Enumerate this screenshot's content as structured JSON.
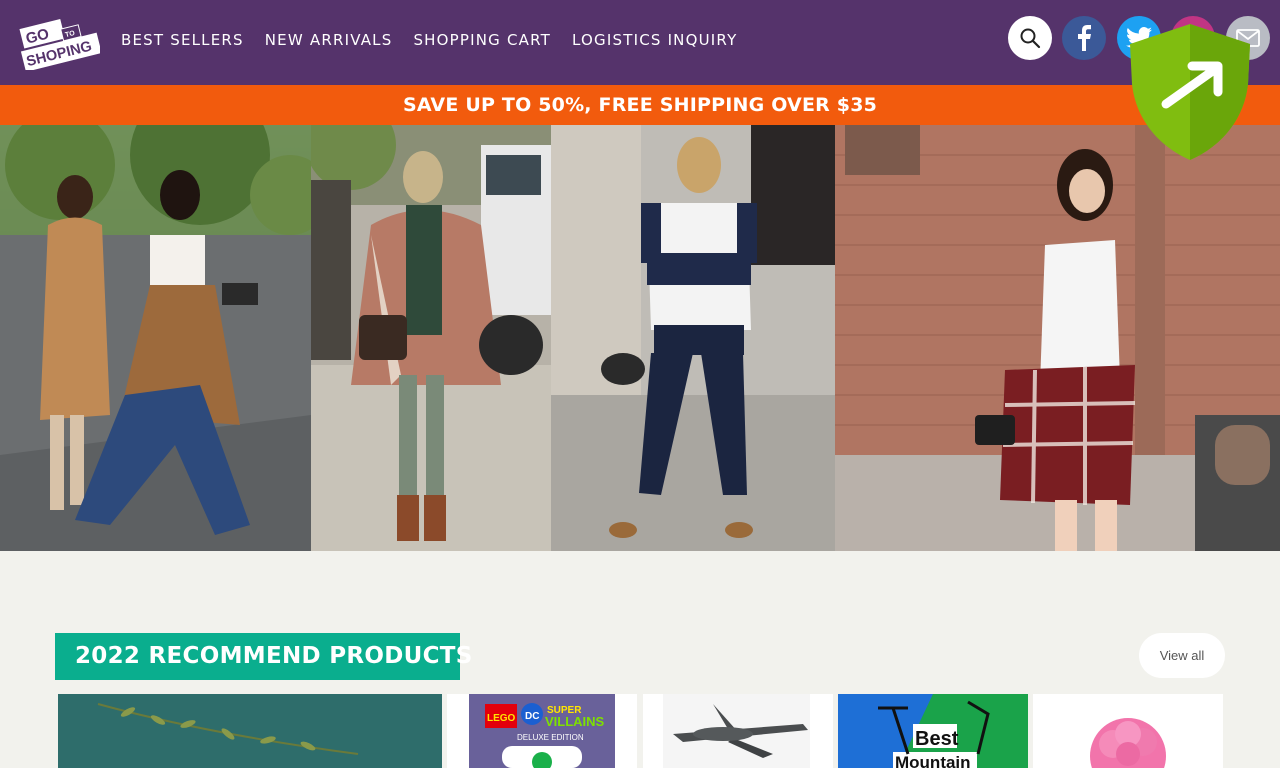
{
  "logo": {
    "top": "GO",
    "to": "TO",
    "bottom": "SHOPING"
  },
  "nav": {
    "items": [
      "BEST SELLERS",
      "NEW ARRIVALS",
      "SHOPPING CART",
      "LOGISTICS INQUIRY"
    ]
  },
  "social": [
    "search-icon",
    "facebook-icon",
    "twitter-icon",
    "instagram-icon",
    "email-icon"
  ],
  "promo": {
    "text": "SAVE UP TO 50%, FREE SHIPPING OVER $35"
  },
  "section": {
    "title": "2022 RECOMMEND PRODUCTS",
    "view_all": "View all"
  },
  "products": [
    {
      "art": ""
    },
    {
      "art": "LEGO DC SUPER-VILLAINS DELUXE EDITION"
    },
    {
      "art": ""
    },
    {
      "art": "Best Mountain"
    },
    {
      "art": ""
    }
  ],
  "colors": {
    "header": "#55336b",
    "promo": "#f25b0d",
    "section": "#0aae8e",
    "background": "#f2f2ed"
  }
}
